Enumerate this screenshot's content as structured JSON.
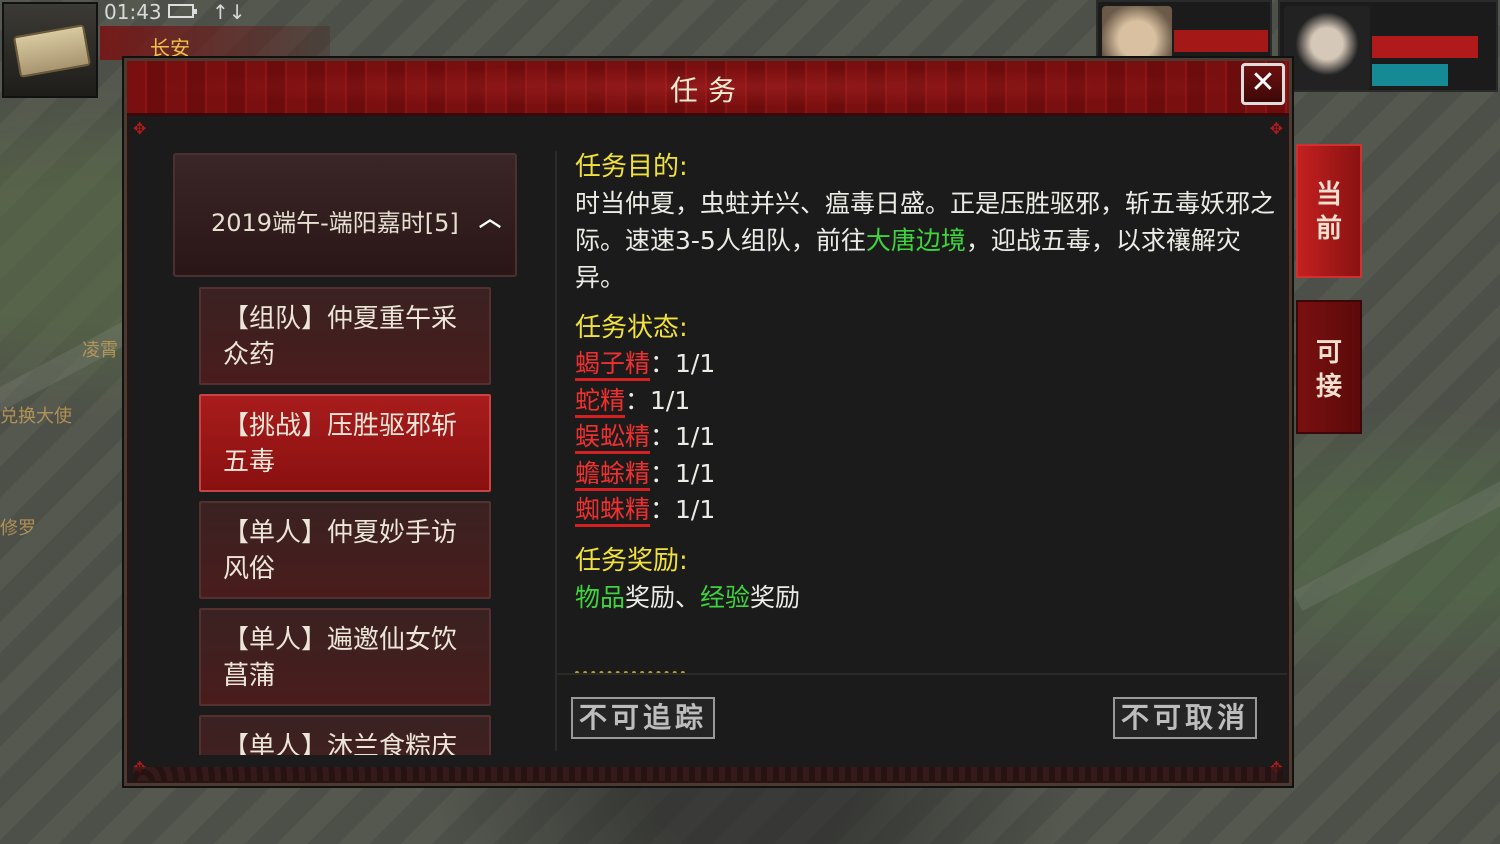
{
  "hud": {
    "time": "01:43",
    "signal": "↑↓",
    "city": "长安"
  },
  "world_labels": [
    "凌霄",
    "兑换大使",
    "修罗"
  ],
  "dialog": {
    "title": "任务",
    "close_symbol": "✕"
  },
  "task_category": {
    "label": "2019端午-端阳嘉时[5]",
    "expanded_symbol": "︿"
  },
  "tasks": [
    {
      "label": "【组队】仲夏重午采众药",
      "selected": false
    },
    {
      "label": "【挑战】压胜驱邪斩五毒",
      "selected": true
    },
    {
      "label": "【单人】仲夏妙手访风俗",
      "selected": false
    },
    {
      "label": "【单人】遍邀仙女饮菖蒲",
      "selected": false
    },
    {
      "label": "【单人】沐兰食粽庆",
      "selected": false
    }
  ],
  "detail": {
    "objective_title": "任务目的:",
    "objective_text_1": "时当仲夏，虫蛀并兴、瘟毒日盛。正是压胜驱邪，斩五毒妖邪之际。速速3-5人组队，前往",
    "objective_location": "大唐边境",
    "objective_text_2": "，迎战五毒，以求禳解灾异。",
    "status_title": "任务状态:",
    "status": [
      {
        "name": "蝎子精",
        "progress": "：1/1"
      },
      {
        "name": "蛇精",
        "progress": "：1/1"
      },
      {
        "name": "蜈蚣精",
        "progress": "：1/1"
      },
      {
        "name": "蟾蜍精",
        "progress": "：1/1"
      },
      {
        "name": "蜘蛛精",
        "progress": "：1/1"
      }
    ],
    "reward_title": "任务奖励:",
    "reward_item": "物品",
    "reward_item_suffix": "奖励、",
    "reward_exp": "经验",
    "reward_exp_suffix": "奖励"
  },
  "buttons": {
    "track": "不可追踪",
    "cancel": "不可取消"
  },
  "side_tabs": [
    {
      "label": "当前",
      "active": true
    },
    {
      "label": "可接",
      "active": false
    }
  ],
  "colors": {
    "accent_red": "#8a1212",
    "title_yellow": "#f0e23a",
    "highlight_green": "#3ed43e",
    "monster_red": "#ef3030"
  }
}
